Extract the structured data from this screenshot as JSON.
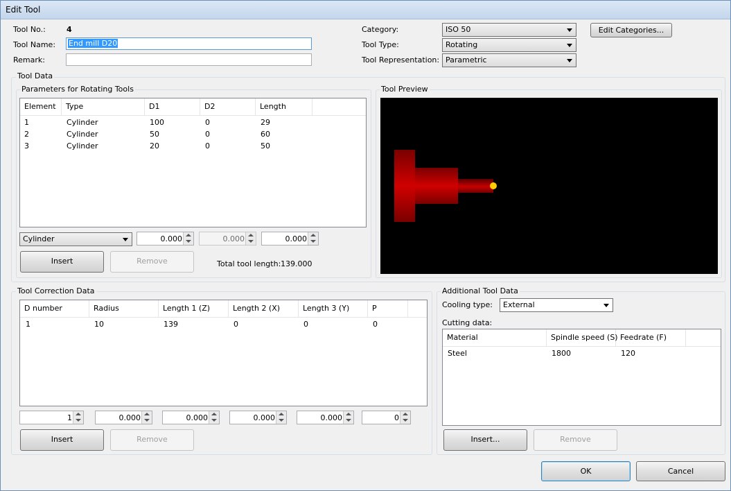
{
  "window": {
    "title": "Edit Tool"
  },
  "tool": {
    "no_label": "Tool No.:",
    "no_value": "4",
    "name_label": "Tool Name:",
    "name_value": "End mill D20",
    "remark_label": "Remark:",
    "remark_value": ""
  },
  "category": {
    "category_label": "Category:",
    "category_value": "ISO 50",
    "type_label": "Tool Type:",
    "type_value": "Rotating",
    "repr_label": "Tool Representation:",
    "repr_value": "Parametric",
    "edit_button": "Edit Categories..."
  },
  "tool_data": {
    "title": "Tool Data",
    "params": {
      "title": "Parameters for Rotating Tools",
      "columns": [
        "Element",
        "Type",
        "D1",
        "D2",
        "Length"
      ],
      "rows": [
        [
          "1",
          "Cylinder",
          "100",
          "0",
          "29"
        ],
        [
          "2",
          "Cylinder",
          "50",
          "0",
          "60"
        ],
        [
          "3",
          "Cylinder",
          "20",
          "0",
          "50"
        ]
      ],
      "type_select": "Cylinder",
      "spin1": "0.000",
      "spin2": "0.000",
      "spin3": "0.000",
      "insert": "Insert",
      "remove": "Remove",
      "total_label": "Total tool length:",
      "total_value": "139.000"
    },
    "preview": {
      "title": "Tool Preview",
      "colors": {
        "background": "#000000",
        "body": "#c40000",
        "tip": "#ffcc00"
      }
    }
  },
  "correction": {
    "title": "Tool Correction Data",
    "columns": [
      "D number",
      "Radius",
      "Length 1 (Z)",
      "Length 2 (X)",
      "Length 3 (Y)",
      "P"
    ],
    "rows": [
      [
        "1",
        "10",
        "139",
        "0",
        "0",
        "0"
      ]
    ],
    "spins": [
      "1",
      "0.000",
      "0.000",
      "0.000",
      "0.000",
      "0"
    ],
    "insert": "Insert",
    "remove": "Remove"
  },
  "additional": {
    "title": "Additional Tool Data",
    "cooling_label": "Cooling type:",
    "cooling_value": "External",
    "cutting_label": "Cutting data:",
    "columns": [
      "Material",
      "Spindle speed (S)",
      "Feedrate (F)"
    ],
    "rows": [
      [
        "Steel",
        "1800",
        "120"
      ]
    ],
    "insert": "Insert...",
    "remove": "Remove"
  },
  "footer": {
    "ok": "OK",
    "cancel": "Cancel"
  }
}
